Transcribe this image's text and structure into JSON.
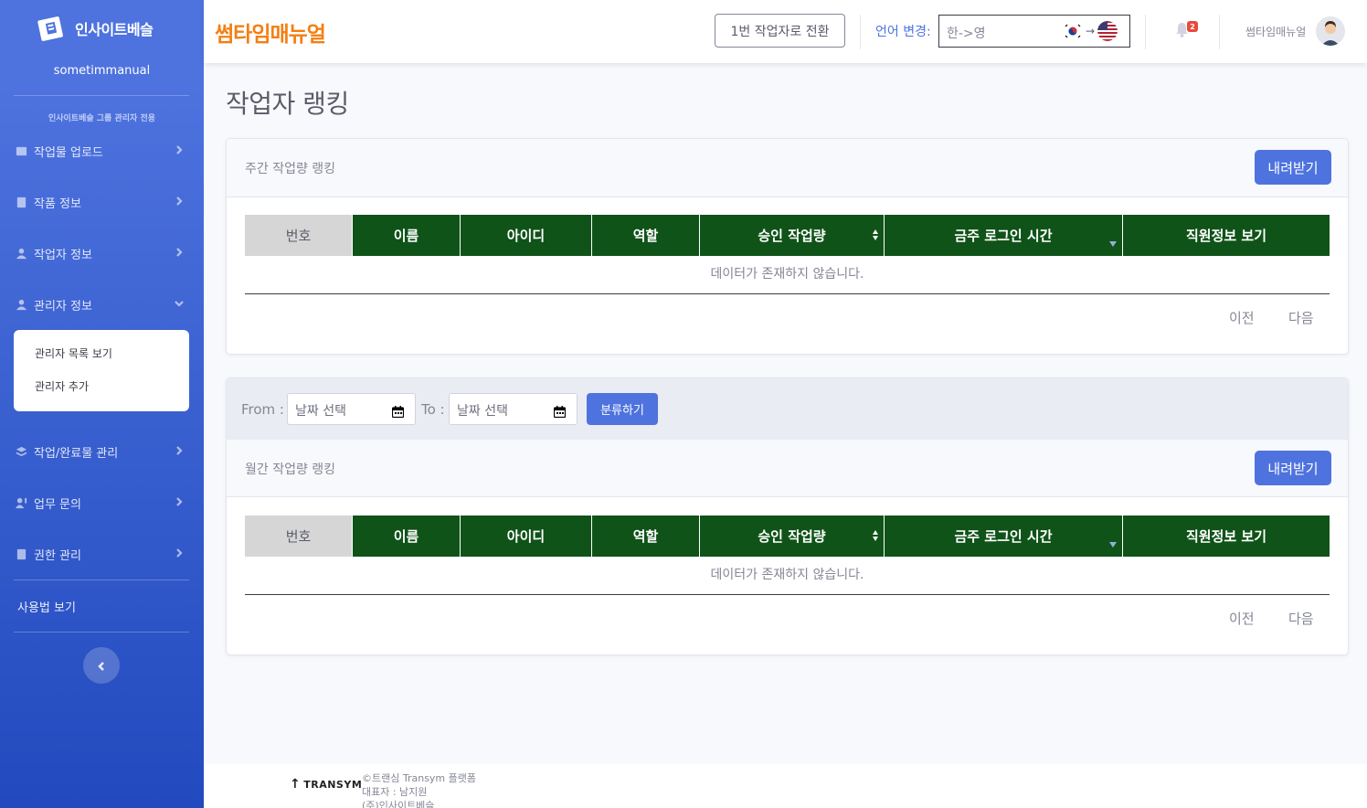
{
  "sidebar": {
    "brand": "인사이트베슬",
    "username": "sometimmanual",
    "group_note": "인사이트베슬 그룹 관리자 전용",
    "items": [
      {
        "label": "작업물 업로드",
        "icon": "upload-icon"
      },
      {
        "label": "작품 정보",
        "icon": "book-icon"
      },
      {
        "label": "작업자 정보",
        "icon": "user-icon"
      },
      {
        "label": "관리자 정보",
        "icon": "user-cog-icon"
      },
      {
        "label": "작업/완료물 관리",
        "icon": "layers-icon"
      },
      {
        "label": "업무 문의",
        "icon": "user-question-icon"
      },
      {
        "label": "권한 관리",
        "icon": "file-icon"
      }
    ],
    "submenu": [
      "관리자 목록 보기",
      "관리자 추가"
    ],
    "usage_label": "사용법 보기"
  },
  "topbar": {
    "logo": "썸타임매뉴얼",
    "switch_button": "1번 작업자로 전환",
    "language_label": "언어 변경:",
    "language_value": "한->영",
    "notification_count": "2",
    "user_name": "썸타임매뉴얼"
  },
  "main": {
    "page_title": "작업자 랭킹",
    "weekly": {
      "title": "주간 작업량 랭킹",
      "download_label": "내려받기"
    },
    "filter": {
      "from_label": "From :",
      "to_label": "To :",
      "from_placeholder": "날짜 선택",
      "to_placeholder": "날짜 선택",
      "classify_label": "분류하기"
    },
    "monthly": {
      "title": "월간 작업량 랭킹",
      "download_label": "내려받기"
    },
    "columns": [
      "번호",
      "이름",
      "아이디",
      "역할",
      "승인 작업량",
      "금주 로그인 시간",
      "직원정보 보기"
    ],
    "empty_message": "데이터가 존재하지 않습니다.",
    "prev_label": "이전",
    "next_label": "다음"
  },
  "footer": {
    "logo_text": "TRANSYM",
    "line1": "©트랜심 Transym 플랫폼",
    "line2": "대표자 : 남지원",
    "line3": "(주)인사이트베슬"
  },
  "colors": {
    "sidebar_top": "#4e73df",
    "sidebar_bottom": "#224abe",
    "header_green": "#0f5318",
    "accent": "#4e73df",
    "logo_orange": "#f47f13"
  }
}
